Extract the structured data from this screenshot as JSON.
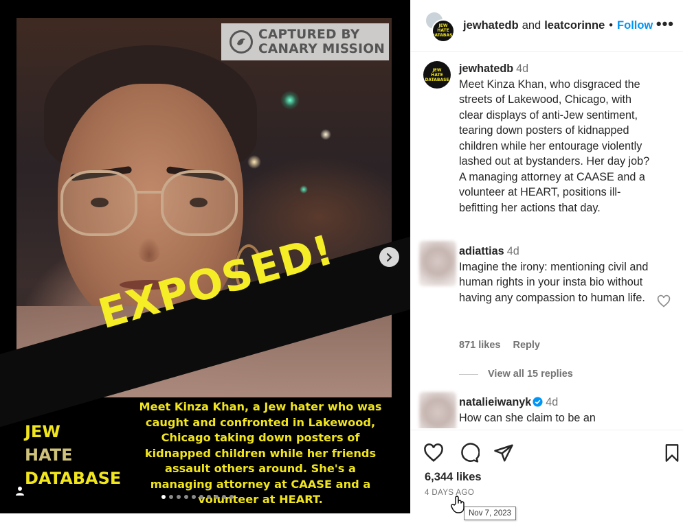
{
  "media": {
    "watermark_text": "CAPTURED BY\nCANARY MISSION",
    "banner_text": "EXPOSED!",
    "caption": "Meet Kinza Khan, a Jew hater who was caught and confronted in Lakewood, Chicago taking down posters of kidnapped children while her friends assault others around. She's a managing attorney at CAASE and a volunteer at HEART.",
    "brand_line1": "JEW",
    "brand_line2": "HATE",
    "brand_line3": "DATABASE",
    "slide_count": 10,
    "active_slide": 1
  },
  "header": {
    "user1": "jewhatedb",
    "conjunction": "and",
    "user2": "leatcorinne",
    "separator": "•",
    "follow_label": "Follow",
    "more_label": "•••"
  },
  "avatar_text": [
    "JEW",
    "HATE",
    "DATABASE"
  ],
  "caption_comment": {
    "username": "jewhatedb",
    "time": "4d",
    "text": "Meet Kinza Khan, who disgraced the streets of Lakewood, Chicago, with clear displays of anti-Jew sentiment, tearing down posters of kidnapped children while her entourage violently lashed out at bystanders. Her day job? A managing attorney at CAASE and a volunteer at HEART, positions ill-befitting her actions that day."
  },
  "comments": [
    {
      "username": "adiattias",
      "time": "4d",
      "text": "Imagine the irony: mentioning civil and human rights in your insta bio without having any compassion to human life.",
      "likes": "871 likes",
      "reply_label": "Reply",
      "view_replies": "View all 15 replies"
    },
    {
      "username": "natalieiwanyk",
      "time": "4d",
      "text": "How can she claim to be an",
      "verified": true
    }
  ],
  "actions": {
    "likes": "6,344 likes",
    "posted_ago": "4 DAYS AGO",
    "tooltip": "Nov 7, 2023"
  },
  "colors": {
    "accent": "#0095f6",
    "banner_yellow": "#f5ee26",
    "caption_yellow": "#f1e51d",
    "muted": "#737373"
  }
}
